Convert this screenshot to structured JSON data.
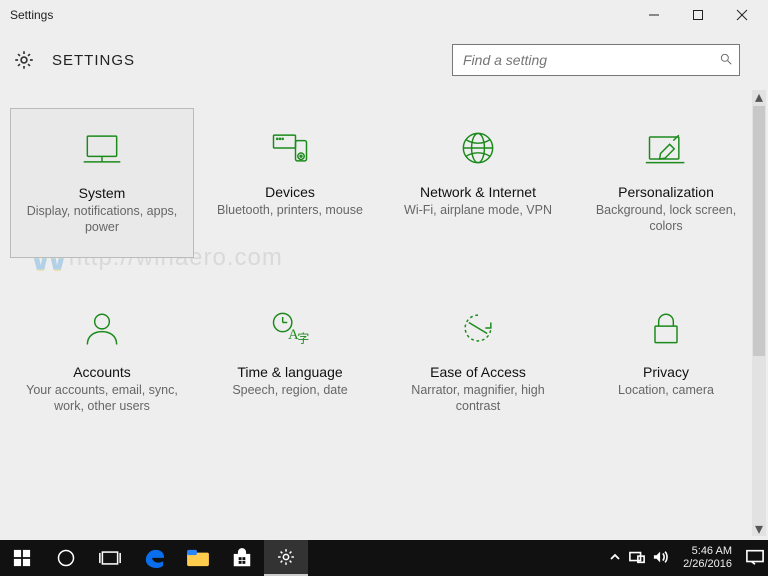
{
  "window": {
    "title": "Settings",
    "app_label": "SETTINGS",
    "search_placeholder": "Find a setting"
  },
  "tiles": [
    {
      "name": "System",
      "desc": "Display, notifications, apps, power",
      "icon": "monitor",
      "selected": true
    },
    {
      "name": "Devices",
      "desc": "Bluetooth, printers, mouse",
      "icon": "devices",
      "selected": false
    },
    {
      "name": "Network & Internet",
      "desc": "Wi-Fi, airplane mode, VPN",
      "icon": "globe",
      "selected": false
    },
    {
      "name": "Personalization",
      "desc": "Background, lock screen, colors",
      "icon": "personalize",
      "selected": false
    },
    {
      "name": "Accounts",
      "desc": "Your accounts, email, sync, work, other users",
      "icon": "person",
      "selected": false
    },
    {
      "name": "Time & language",
      "desc": "Speech, region, date",
      "icon": "time-lang",
      "selected": false
    },
    {
      "name": "Ease of Access",
      "desc": "Narrator, magnifier, high contrast",
      "icon": "ease",
      "selected": false
    },
    {
      "name": "Privacy",
      "desc": "Location, camera",
      "icon": "lock",
      "selected": false
    }
  ],
  "watermark": "http://winaero.com",
  "tray": {
    "time": "5:46 AM",
    "date": "2/26/2016"
  }
}
